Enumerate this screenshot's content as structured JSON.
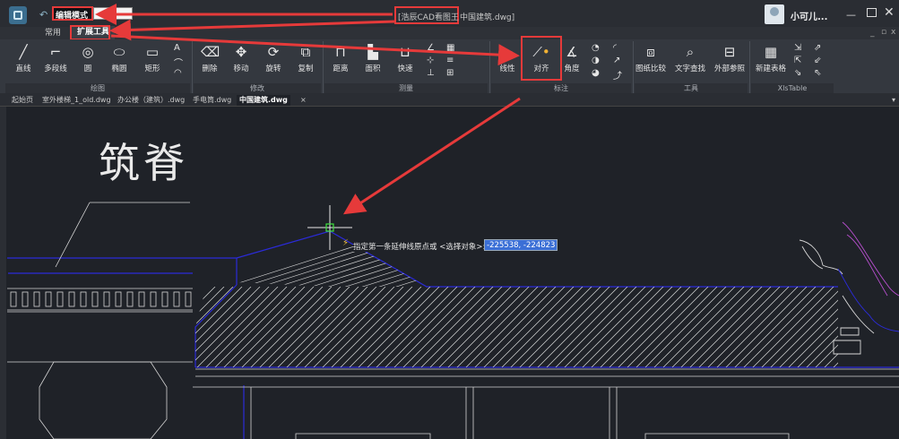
{
  "titlebar": {
    "mode_label": "编辑模式",
    "app_title": "[浩辰CAD看图王",
    "doc_title": "中国建筑.dwg]",
    "username": "小可儿...",
    "min_glyph": "—",
    "close_glyph": "✕"
  },
  "ribbon_tabs": [
    "常用",
    "扩展工具"
  ],
  "sub_window": {
    "min": "_",
    "restore": "▫",
    "close": "x"
  },
  "groups": {
    "draw": {
      "label": "绘图",
      "tools": [
        "直线",
        "多段线",
        "圆",
        "椭圆",
        "矩形"
      ]
    },
    "modify": {
      "label": "修改",
      "tools": [
        "删除",
        "移动",
        "旋转",
        "复制"
      ]
    },
    "measure": {
      "label": "测量",
      "tools": [
        "距离",
        "面积",
        "快速"
      ]
    },
    "annotate": {
      "label": "标注",
      "tools": [
        "线性",
        "对齐",
        "角度"
      ]
    },
    "tools": {
      "label": "工具",
      "tools": [
        "图纸比较",
        "文字查找",
        "外部参照"
      ]
    },
    "xls": {
      "label": "XlsTable",
      "tools": [
        "新建表格"
      ]
    }
  },
  "doc_tabs": [
    "起始页",
    "室外楼梯_1_old.dwg",
    "办公楼（建筑）.dwg",
    "手电筒.dwg",
    "中国建筑.dwg"
  ],
  "drawing": {
    "big_text": "筑脊"
  },
  "prompt": {
    "text": "指定第一条延伸线原点或 <选择对象>:",
    "coords": "-225538, -224823"
  },
  "colors": {
    "highlight": "#e63a3a",
    "outline": "#2b2bd8",
    "accent_dot": "#f2b233",
    "input_bg": "#3b6fd6"
  }
}
